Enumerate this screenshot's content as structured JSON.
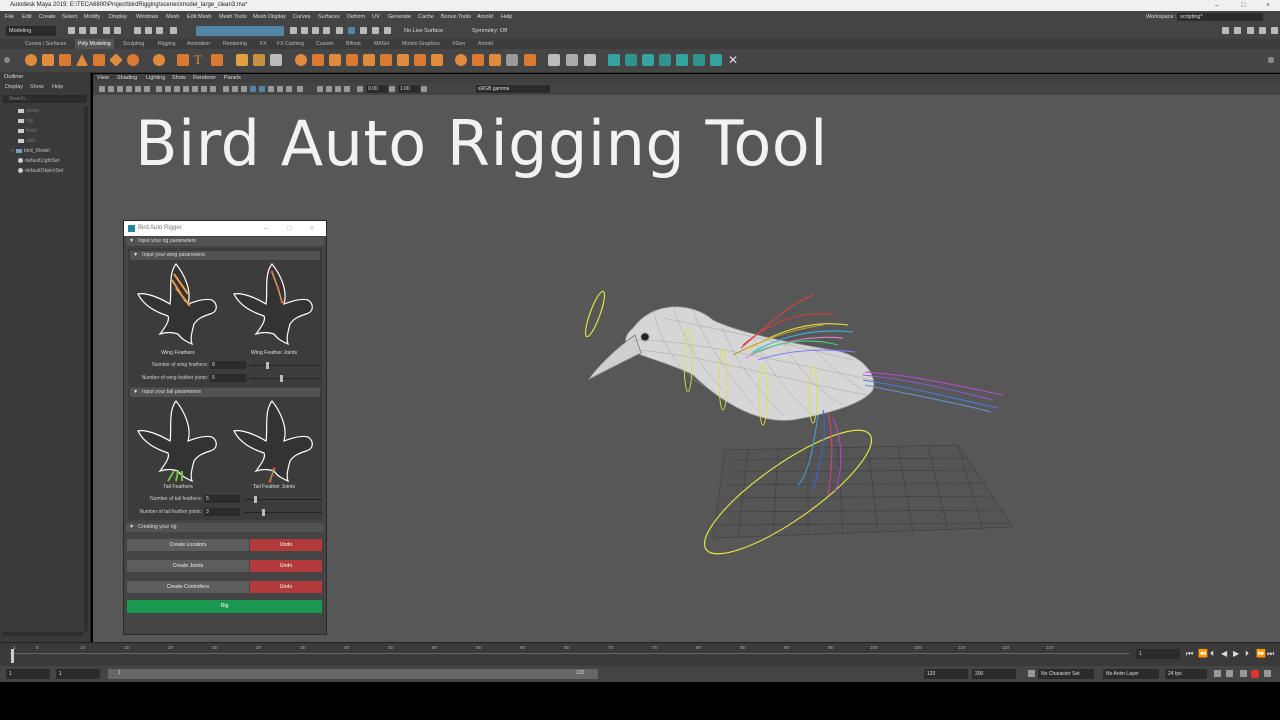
{
  "app": {
    "title": "Autodesk Maya 2019: E:\\TECA6800\\Project\\birdRigging\\scenes\\model_large_clean3.ma*",
    "window_controls": [
      "–",
      "□",
      "×"
    ]
  },
  "menubar": {
    "items": [
      "File",
      "Edit",
      "Create",
      "Select",
      "Modify",
      "Display",
      "Windows",
      "Mesh",
      "Edit Mesh",
      "Mesh Tools",
      "Mesh Display",
      "Curves",
      "Surfaces",
      "Deform",
      "UV",
      "Generate",
      "Cache",
      "Bonus Tools",
      "Arnold",
      "Help"
    ],
    "workspace_label": "Workspace :",
    "workspace_value": "scripting*"
  },
  "statusline": {
    "mode": "Modeling",
    "live_surface": "No Live Surface",
    "symmetry": "Symmetry: Off"
  },
  "shelf_tabs": {
    "items": [
      "Curves / Surfaces",
      "Poly Modeling",
      "Sculpting",
      "Rigging",
      "Animation",
      "Rendering",
      "FX",
      "FX Caching",
      "Custom",
      "Bifrost",
      "MASH",
      "Motion Graphics",
      "XGen",
      "Arnold"
    ],
    "active": "Poly Modeling"
  },
  "outliner": {
    "title": "Outliner",
    "menu": [
      "Display",
      "Show",
      "Help"
    ],
    "search_placeholder": "Search...",
    "items": [
      "persp",
      "top",
      "front",
      "side",
      "bird_Model",
      "defaultLightSet",
      "defaultObjectSet"
    ]
  },
  "viewport": {
    "menu": [
      "View",
      "Shading",
      "Lighting",
      "Show",
      "Renderer",
      "Panels"
    ],
    "exposure": "0.00",
    "gamma": "1.00",
    "color_space": "sRGB gamma",
    "overlay_title": "Bird Auto Rigging Tool"
  },
  "rig_window": {
    "title": "Bird Auto Rigger",
    "section_main": "Input your rig parameters",
    "section_wing": "Input your wing parameters",
    "wing_caption_1": "Wing Feathers",
    "wing_caption_2": "Wing Feather Joints",
    "wing_feathers_label": "Number of wing feathers:",
    "wing_feathers_value": "8",
    "wing_joints_label": "Number of wing feather joints:",
    "wing_joints_value": "5",
    "section_tail": "Input your tail parameters",
    "tail_caption_1": "Tail Feathers",
    "tail_caption_2": "Tail Feather Joints",
    "tail_feathers_label": "Number of tail feathers:",
    "tail_feathers_value": "5",
    "tail_joints_label": "Number of tail feather joints:",
    "tail_joints_value": "3",
    "section_create": "Creating your rig",
    "create_locators": "Create Locators",
    "create_joints": "Create Joints",
    "create_controllers": "Create Controllers",
    "undo": "Undo",
    "rig": "Rig"
  },
  "timeline": {
    "ticks": [
      "1",
      "5",
      "10",
      "15",
      "20",
      "25",
      "30",
      "35",
      "40",
      "45",
      "50",
      "55",
      "60",
      "65",
      "70",
      "75",
      "80",
      "85",
      "90",
      "95",
      "100",
      "105",
      "110",
      "115",
      "120"
    ],
    "current_frame": "1"
  },
  "range": {
    "start": "1",
    "start_inner": "1",
    "range_inner_start": "1",
    "range_inner_end": "120",
    "end": "120",
    "anim_end": "200",
    "character_set": "No Character Set",
    "anim_layer": "No Anim Layer",
    "fps": "24 fps"
  }
}
